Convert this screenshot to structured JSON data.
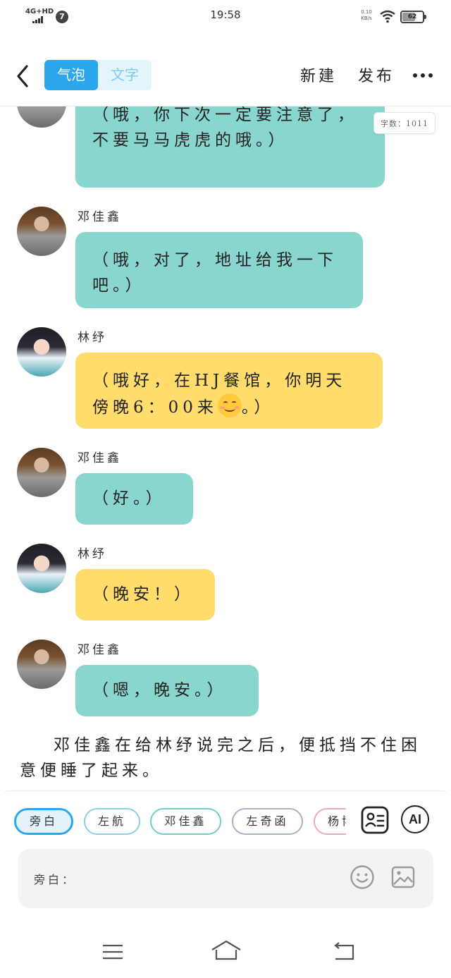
{
  "status_bar": {
    "network": "4G+HD",
    "notification_count": "7",
    "time": "19:58",
    "speed_value": "0.10",
    "speed_unit": "KB/s",
    "battery": "62"
  },
  "toolbar": {
    "mode_bubble": "气泡",
    "mode_text": "文字",
    "new_label": "新建",
    "publish_label": "发布"
  },
  "word_count": "字数：1011",
  "messages": [
    {
      "sender": "",
      "text": "（哦，你下次一定要注意了，不要马马虎虎的哦。）"
    },
    {
      "sender": "邓佳鑫",
      "text": "（哦，对了，地址给我一下吧。）"
    },
    {
      "sender": "林纾",
      "text_before_emoji": "（哦好，在HJ餐馆，你明天傍晚6：00来",
      "text_after_emoji": "。）"
    },
    {
      "sender": "邓佳鑫",
      "text": "（好。）"
    },
    {
      "sender": "林纾",
      "text": "（晚安！）"
    },
    {
      "sender": "邓佳鑫",
      "text": "（嗯，晚安。）"
    }
  ],
  "narration": "邓佳鑫在给林纾说完之后，便抵挡不住困意便睡了起来。",
  "roles": [
    "旁白",
    "左航",
    "邓佳鑫",
    "左奇函",
    "杨博"
  ],
  "ai_label": "AI",
  "input": {
    "label": "旁白："
  },
  "icons": {
    "back": "back-arrow-icon",
    "more": "more-dots-icon",
    "role_card": "role-card-icon",
    "emoji": "emoji-icon",
    "image": "image-icon"
  },
  "colors": {
    "accent": "#2aa6ec",
    "teal_bubble": "#88d6cd",
    "yellow_bubble": "#ffdc6b"
  }
}
